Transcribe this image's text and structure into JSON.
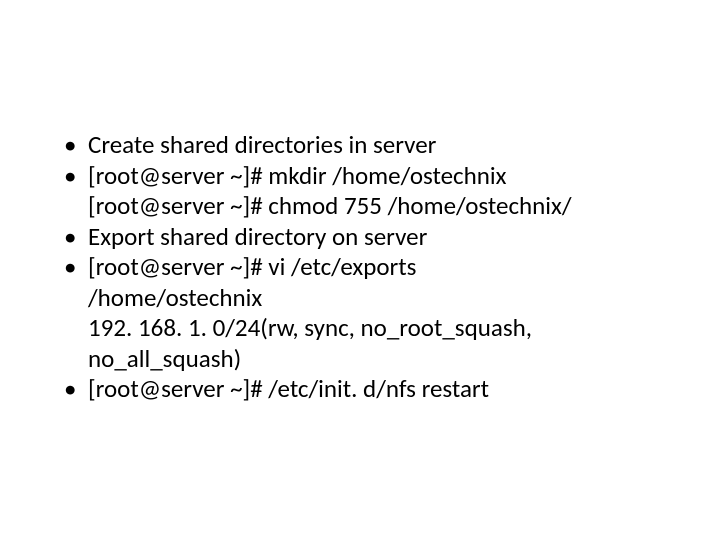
{
  "slide": {
    "bullets": [
      {
        "lines": [
          "Create shared directories in server"
        ]
      },
      {
        "lines": [
          "[root@server ~]# mkdir /home/ostechnix",
          "[root@server ~]# chmod 755 /home/ostechnix/"
        ]
      },
      {
        "lines": [
          "Export shared directory on server"
        ]
      },
      {
        "lines": [
          "[root@server ~]# vi /etc/exports",
          "/home/ostechnix",
          "192. 168. 1. 0/24(rw, sync, no_root_squash, no_all_squash)"
        ]
      },
      {
        "lines": [
          "[root@server ~]# /etc/init. d/nfs restart"
        ]
      }
    ]
  }
}
